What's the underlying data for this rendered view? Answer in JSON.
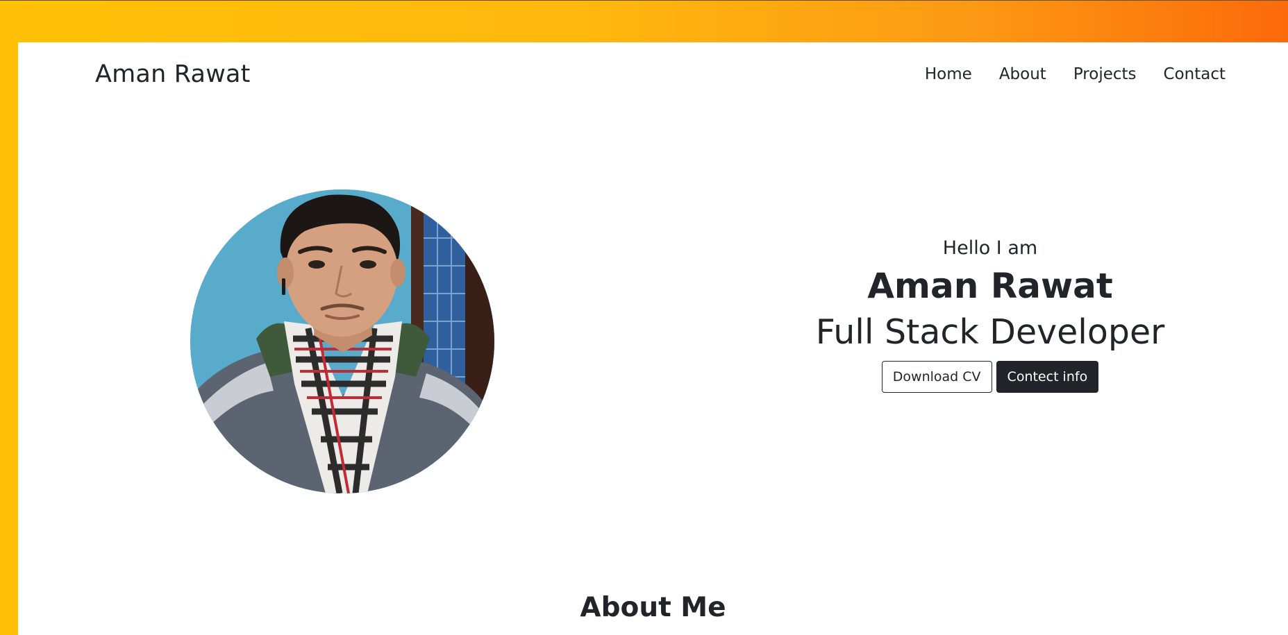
{
  "colors": {
    "frame_gradient_start": "#ffc107",
    "frame_gradient_end": "#fc6a0a",
    "text": "#212529",
    "dark_button": "#212529",
    "page_background": "#ffffff"
  },
  "navbar": {
    "brand": "Aman Rawat",
    "links": [
      {
        "label": "Home"
      },
      {
        "label": "About"
      },
      {
        "label": "Projects"
      },
      {
        "label": "Contact"
      }
    ]
  },
  "hero": {
    "profile_image": "profile-photo",
    "greeting": "Hello I am",
    "name": "Aman Rawat",
    "role": "Full Stack Developer",
    "buttons": {
      "download_cv": "Download CV",
      "contact_info": "Contect info"
    }
  },
  "about": {
    "title": "About Me"
  }
}
